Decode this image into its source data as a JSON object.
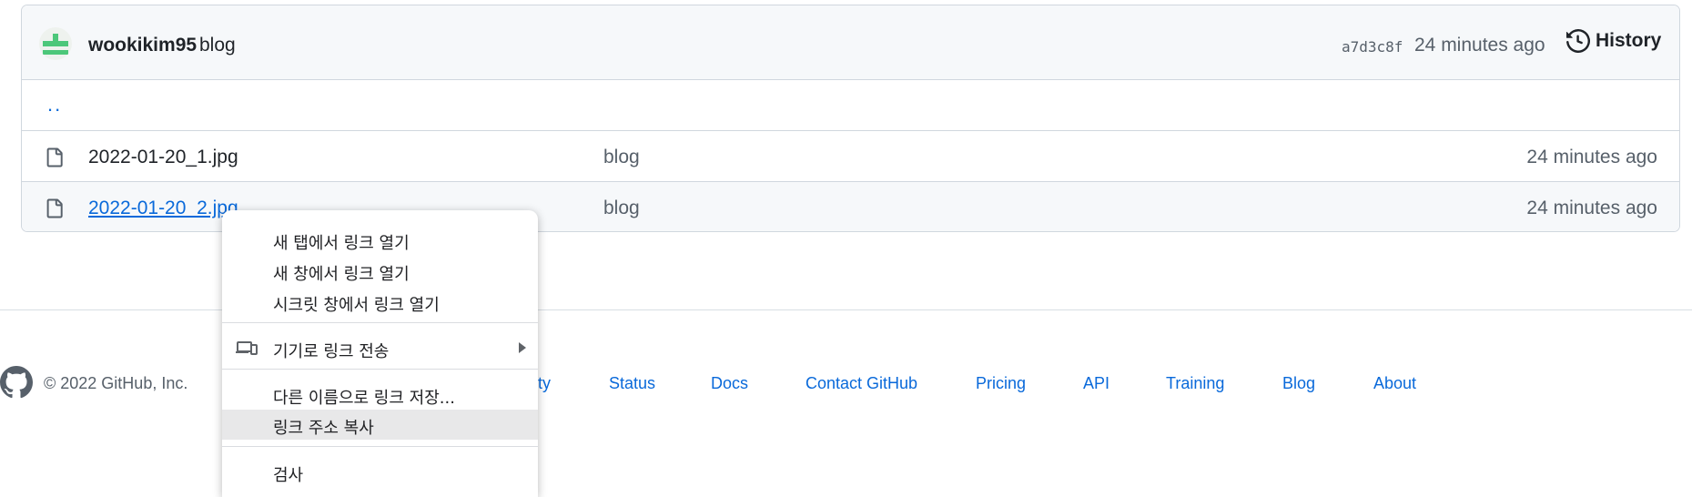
{
  "commit": {
    "owner": "wookikim95",
    "message": "blog",
    "sha": "a7d3c8f",
    "time": "24 minutes ago",
    "history_label": "History"
  },
  "parent_dir": "..",
  "files": [
    {
      "name": "2022-01-20_1.jpg",
      "commit_message": "blog",
      "age": "24 minutes ago"
    },
    {
      "name": "2022-01-20_2.jpg",
      "commit_message": "blog",
      "age": "24 minutes ago"
    }
  ],
  "footer": {
    "copyright": "© 2022 GitHub, Inc.",
    "partial_link": "ty",
    "links": [
      "Status",
      "Docs",
      "Contact GitHub",
      "Pricing",
      "API",
      "Training",
      "Blog",
      "About"
    ]
  },
  "context_menu": {
    "items": [
      "새 탭에서 링크 열기",
      "새 창에서 링크 열기",
      "시크릿 창에서 링크 열기",
      "기기로 링크 전송",
      "다른 이름으로 링크 저장...",
      "링크 주소 복사",
      "검사"
    ]
  },
  "colors": {
    "link": "#0969da",
    "muted": "#57606a",
    "border": "#d0d7de",
    "avatar_green": "#4cc77a",
    "menu_highlight": "#e8e8e9"
  },
  "icons": {
    "history": "history-clock-icon",
    "file": "file-icon",
    "github": "github-mark-icon",
    "send_to_device": "devices-icon",
    "submenu": "chevron-right-icon"
  }
}
